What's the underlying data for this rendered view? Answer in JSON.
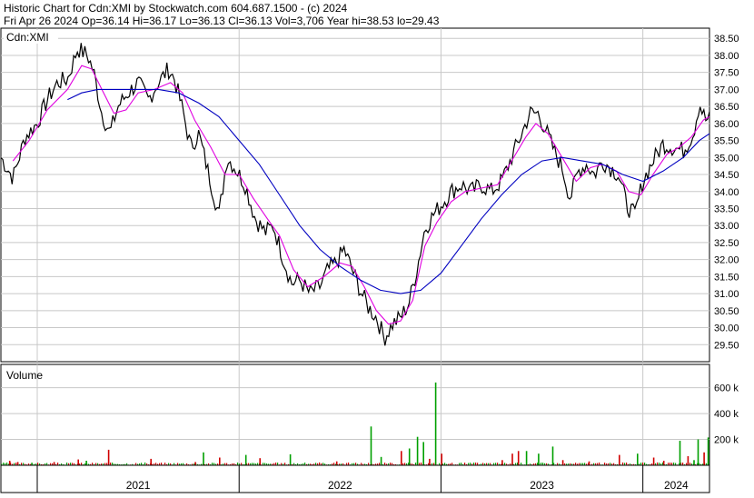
{
  "header": {
    "line1": "Historic Chart for Cdn:XMI by Stockwatch.com 604.687.1500 - (c) 2024",
    "line2": "Fri Apr 26 2024   Op=36.14  Hi=36.17  Lo=36.13  Cl=36.13  Vol=3,706  Year hi=38.53  lo=29.43"
  },
  "chart_data": [
    {
      "type": "line",
      "title": "Cdn:XMI",
      "ylim": [
        29.0,
        38.8
      ],
      "yticks": [
        "38.50",
        "38.00",
        "37.50",
        "37.00",
        "36.50",
        "36.00",
        "35.50",
        "35.00",
        "34.50",
        "34.00",
        "33.50",
        "33.00",
        "32.50",
        "32.00",
        "31.50",
        "31.00",
        "30.50",
        "30.00",
        "29.50"
      ],
      "ytick_values": [
        38.5,
        38.0,
        37.5,
        37.0,
        36.5,
        36.0,
        35.5,
        35.0,
        34.5,
        34.0,
        33.5,
        33.0,
        32.5,
        32.0,
        31.5,
        31.0,
        30.5,
        30.0,
        29.5
      ],
      "x_range": [
        2020.82,
        2024.33
      ],
      "x_labels": [
        "2021",
        "2022",
        "2023",
        "2024"
      ],
      "year_boundaries": [
        2021.0,
        2022.0,
        2023.0,
        2024.0
      ],
      "price_points": [
        [
          2020.82,
          35.0
        ],
        [
          2020.88,
          34.4
        ],
        [
          2020.94,
          35.6
        ],
        [
          2021.0,
          36.0
        ],
        [
          2021.05,
          36.7
        ],
        [
          2021.1,
          37.2
        ],
        [
          2021.15,
          37.3
        ],
        [
          2021.2,
          38.2
        ],
        [
          2021.25,
          38.0
        ],
        [
          2021.28,
          37.5
        ],
        [
          2021.32,
          36.3
        ],
        [
          2021.36,
          35.7
        ],
        [
          2021.4,
          36.5
        ],
        [
          2021.45,
          36.9
        ],
        [
          2021.5,
          37.2
        ],
        [
          2021.55,
          36.7
        ],
        [
          2021.6,
          37.2
        ],
        [
          2021.65,
          37.6
        ],
        [
          2021.68,
          37.3
        ],
        [
          2021.72,
          36.4
        ],
        [
          2021.76,
          35.3
        ],
        [
          2021.8,
          35.7
        ],
        [
          2021.85,
          34.5
        ],
        [
          2021.9,
          33.3
        ],
        [
          2021.94,
          35.0
        ],
        [
          2021.98,
          34.7
        ],
        [
          2022.03,
          34.2
        ],
        [
          2022.08,
          33.2
        ],
        [
          2022.13,
          32.8
        ],
        [
          2022.17,
          33.0
        ],
        [
          2022.22,
          32.0
        ],
        [
          2022.26,
          31.3
        ],
        [
          2022.3,
          31.4
        ],
        [
          2022.35,
          31.0
        ],
        [
          2022.4,
          31.2
        ],
        [
          2022.44,
          31.7
        ],
        [
          2022.48,
          31.9
        ],
        [
          2022.52,
          32.3
        ],
        [
          2022.56,
          31.7
        ],
        [
          2022.6,
          31.1
        ],
        [
          2022.64,
          30.6
        ],
        [
          2022.68,
          30.3
        ],
        [
          2022.72,
          29.7
        ],
        [
          2022.76,
          30.1
        ],
        [
          2022.8,
          30.3
        ],
        [
          2022.84,
          30.7
        ],
        [
          2022.88,
          31.7
        ],
        [
          2022.92,
          32.9
        ],
        [
          2022.96,
          33.3
        ],
        [
          2023.0,
          33.6
        ],
        [
          2023.05,
          34.0
        ],
        [
          2023.1,
          34.2
        ],
        [
          2023.15,
          34.0
        ],
        [
          2023.2,
          34.2
        ],
        [
          2023.25,
          34.0
        ],
        [
          2023.3,
          34.3
        ],
        [
          2023.35,
          35.0
        ],
        [
          2023.4,
          35.7
        ],
        [
          2023.44,
          36.3
        ],
        [
          2023.48,
          36.3
        ],
        [
          2023.52,
          35.8
        ],
        [
          2023.56,
          35.2
        ],
        [
          2023.6,
          34.7
        ],
        [
          2023.64,
          33.8
        ],
        [
          2023.68,
          34.6
        ],
        [
          2023.72,
          34.8
        ],
        [
          2023.76,
          34.5
        ],
        [
          2023.8,
          34.9
        ],
        [
          2023.84,
          34.7
        ],
        [
          2023.88,
          34.5
        ],
        [
          2023.92,
          33.6
        ],
        [
          2023.96,
          33.3
        ],
        [
          2024.0,
          34.3
        ],
        [
          2024.05,
          34.9
        ],
        [
          2024.1,
          35.4
        ],
        [
          2024.15,
          35.3
        ],
        [
          2024.2,
          35.2
        ],
        [
          2024.25,
          35.7
        ],
        [
          2024.28,
          36.6
        ],
        [
          2024.31,
          36.1
        ],
        [
          2024.33,
          36.13
        ]
      ],
      "ma_short_points": [
        [
          2020.88,
          34.9
        ],
        [
          2020.96,
          35.5
        ],
        [
          2021.05,
          36.4
        ],
        [
          2021.15,
          37.0
        ],
        [
          2021.22,
          37.7
        ],
        [
          2021.27,
          37.6
        ],
        [
          2021.32,
          37.0
        ],
        [
          2021.38,
          36.3
        ],
        [
          2021.44,
          36.4
        ],
        [
          2021.5,
          36.9
        ],
        [
          2021.58,
          37.0
        ],
        [
          2021.66,
          37.2
        ],
        [
          2021.72,
          36.9
        ],
        [
          2021.78,
          36.1
        ],
        [
          2021.86,
          35.3
        ],
        [
          2021.93,
          34.5
        ],
        [
          2022.0,
          34.5
        ],
        [
          2022.07,
          33.8
        ],
        [
          2022.14,
          33.2
        ],
        [
          2022.2,
          32.7
        ],
        [
          2022.27,
          31.7
        ],
        [
          2022.34,
          31.2
        ],
        [
          2022.42,
          31.5
        ],
        [
          2022.5,
          31.9
        ],
        [
          2022.56,
          31.8
        ],
        [
          2022.62,
          31.2
        ],
        [
          2022.68,
          30.5
        ],
        [
          2022.74,
          30.1
        ],
        [
          2022.8,
          30.2
        ],
        [
          2022.86,
          30.8
        ],
        [
          2022.92,
          32.4
        ],
        [
          2022.98,
          33.1
        ],
        [
          2023.05,
          33.7
        ],
        [
          2023.12,
          34.0
        ],
        [
          2023.2,
          34.1
        ],
        [
          2023.28,
          34.2
        ],
        [
          2023.35,
          34.9
        ],
        [
          2023.42,
          35.6
        ],
        [
          2023.47,
          36.0
        ],
        [
          2023.53,
          35.7
        ],
        [
          2023.6,
          35.0
        ],
        [
          2023.67,
          34.3
        ],
        [
          2023.74,
          34.7
        ],
        [
          2023.8,
          34.8
        ],
        [
          2023.87,
          34.6
        ],
        [
          2023.93,
          34.0
        ],
        [
          2023.99,
          33.9
        ],
        [
          2024.05,
          34.5
        ],
        [
          2024.12,
          35.1
        ],
        [
          2024.18,
          35.3
        ],
        [
          2024.24,
          35.6
        ],
        [
          2024.3,
          36.1
        ],
        [
          2024.33,
          36.2
        ]
      ],
      "ma_long_points": [
        [
          2021.15,
          36.7
        ],
        [
          2021.22,
          36.9
        ],
        [
          2021.3,
          37.0
        ],
        [
          2021.4,
          37.0
        ],
        [
          2021.5,
          37.0
        ],
        [
          2021.6,
          37.0
        ],
        [
          2021.7,
          36.9
        ],
        [
          2021.8,
          36.6
        ],
        [
          2021.9,
          36.2
        ],
        [
          2022.0,
          35.5
        ],
        [
          2022.1,
          34.8
        ],
        [
          2022.2,
          33.9
        ],
        [
          2022.3,
          33.0
        ],
        [
          2022.4,
          32.3
        ],
        [
          2022.5,
          31.8
        ],
        [
          2022.6,
          31.4
        ],
        [
          2022.7,
          31.1
        ],
        [
          2022.8,
          31.0
        ],
        [
          2022.9,
          31.1
        ],
        [
          2023.0,
          31.6
        ],
        [
          2023.1,
          32.4
        ],
        [
          2023.2,
          33.2
        ],
        [
          2023.3,
          33.9
        ],
        [
          2023.4,
          34.5
        ],
        [
          2023.5,
          34.9
        ],
        [
          2023.6,
          35.0
        ],
        [
          2023.7,
          34.9
        ],
        [
          2023.8,
          34.8
        ],
        [
          2023.9,
          34.5
        ],
        [
          2024.0,
          34.3
        ],
        [
          2024.1,
          34.6
        ],
        [
          2024.2,
          35.0
        ],
        [
          2024.28,
          35.5
        ],
        [
          2024.33,
          35.7
        ]
      ],
      "colors": {
        "price": "#000000",
        "ma_short": "#e000e0",
        "ma_long": "#0000c0",
        "grid": "#c8c8c8"
      }
    },
    {
      "type": "bar",
      "title": "Volume",
      "ylim": [
        0,
        780
      ],
      "yticks": [
        "600 k",
        "400 k",
        "200 k"
      ],
      "ytick_values": [
        600,
        400,
        200
      ],
      "units": "thousands",
      "baseline_volume": 12,
      "spikes": [
        [
          2020.86,
          35,
          "red"
        ],
        [
          2020.9,
          25,
          "red"
        ],
        [
          2020.97,
          20,
          "green"
        ],
        [
          2021.08,
          25,
          "red"
        ],
        [
          2021.2,
          45,
          "red"
        ],
        [
          2021.24,
          35,
          "green"
        ],
        [
          2021.35,
          120,
          "red"
        ],
        [
          2021.56,
          50,
          "red"
        ],
        [
          2021.78,
          25,
          "red"
        ],
        [
          2021.82,
          100,
          "green"
        ],
        [
          2021.9,
          60,
          "red"
        ],
        [
          2022.03,
          80,
          "green"
        ],
        [
          2022.1,
          55,
          "red"
        ],
        [
          2022.25,
          85,
          "green"
        ],
        [
          2022.48,
          30,
          "red"
        ],
        [
          2022.65,
          300,
          "green"
        ],
        [
          2022.7,
          65,
          "green"
        ],
        [
          2022.8,
          110,
          "red"
        ],
        [
          2022.84,
          130,
          "green"
        ],
        [
          2022.88,
          220,
          "green"
        ],
        [
          2022.91,
          180,
          "green"
        ],
        [
          2022.94,
          50,
          "red"
        ],
        [
          2022.97,
          640,
          "green"
        ],
        [
          2023.0,
          90,
          "red"
        ],
        [
          2023.3,
          40,
          "red"
        ],
        [
          2023.35,
          90,
          "red"
        ],
        [
          2023.38,
          110,
          "red"
        ],
        [
          2023.42,
          110,
          "green"
        ],
        [
          2023.48,
          90,
          "green"
        ],
        [
          2023.55,
          145,
          "green"
        ],
        [
          2023.6,
          40,
          "red"
        ],
        [
          2023.73,
          30,
          "red"
        ],
        [
          2023.88,
          80,
          "red"
        ],
        [
          2023.97,
          90,
          "green"
        ],
        [
          2024.05,
          60,
          "red"
        ],
        [
          2024.1,
          35,
          "red"
        ],
        [
          2024.18,
          190,
          "green"
        ],
        [
          2024.22,
          70,
          "red"
        ],
        [
          2024.25,
          40,
          "green"
        ],
        [
          2024.27,
          200,
          "green"
        ],
        [
          2024.3,
          100,
          "red"
        ],
        [
          2024.32,
          215,
          "green"
        ]
      ]
    }
  ]
}
